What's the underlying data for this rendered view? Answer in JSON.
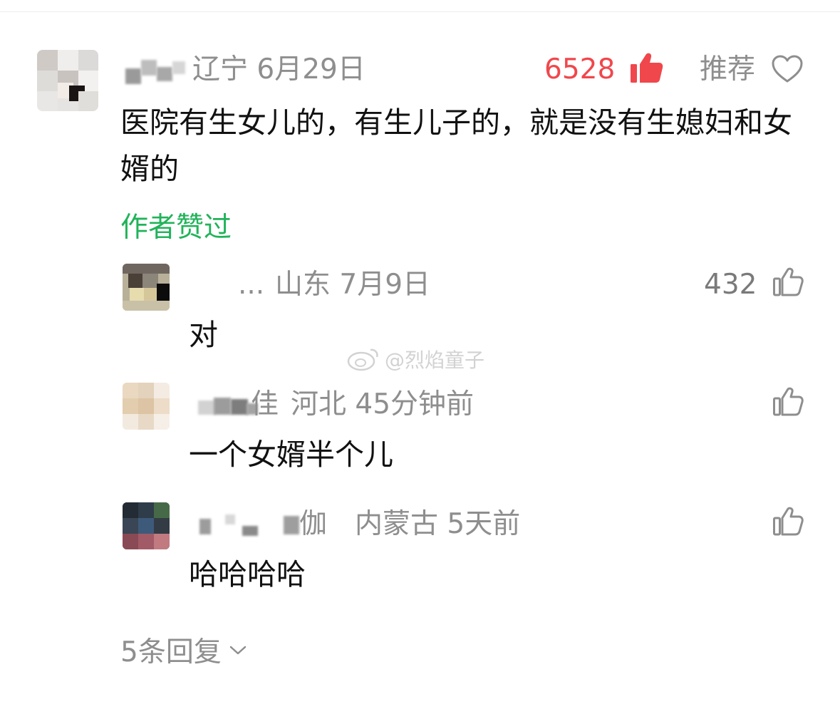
{
  "main_comment": {
    "location_date": "辽宁 6月29日",
    "like_count": "6528",
    "recommend_label": "推荐",
    "text": "医院有生女儿的，有生儿子的，就是没有生媳妇和女婿的",
    "author_liked_label": "作者赞过"
  },
  "replies": [
    {
      "name_tail": "...",
      "location_date": "山东 7月9日",
      "like_count": "432",
      "text": "对"
    },
    {
      "name_tail": "佳",
      "location_date": "河北 45分钟前",
      "like_count": "",
      "text": "一个女婿半个儿"
    },
    {
      "name_tail": "伽",
      "location_date": "内蒙古 5天前",
      "like_count": "",
      "text": "哈哈哈哈"
    }
  ],
  "more_replies_label": "5条回复",
  "watermark": "@烈焰童子",
  "colors": {
    "like_hot": "#f0474c",
    "liked_green": "#21b35a",
    "meta_gray": "#8e8e8e"
  },
  "icons": [
    "thumbs-up-filled-icon",
    "heart-outline-icon",
    "thumbs-up-outline-icon",
    "chevron-down-icon",
    "weibo-logo-icon"
  ]
}
